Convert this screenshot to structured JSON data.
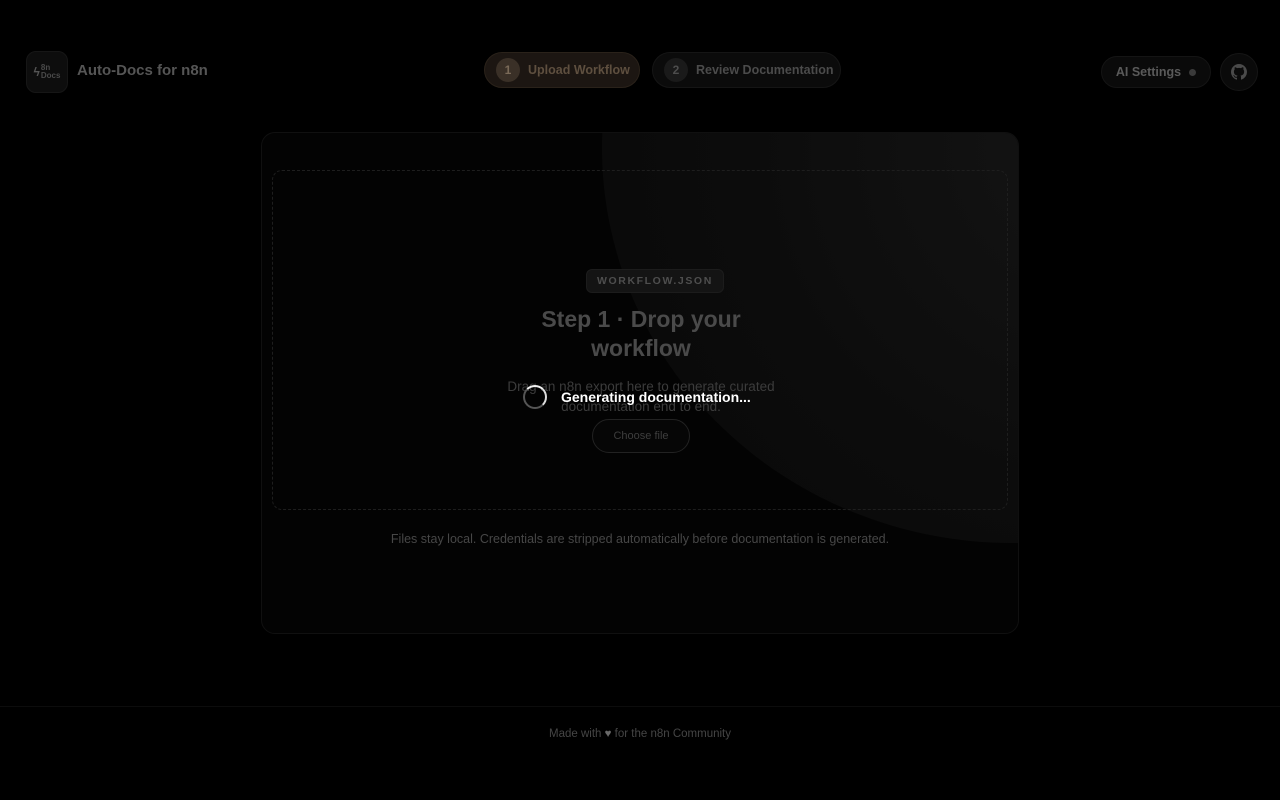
{
  "header": {
    "logo_top": "8n",
    "logo_bottom": "Docs",
    "app_title": "Auto-Docs for n8n",
    "steps": [
      {
        "number": "1",
        "label": "Upload Workflow",
        "active": true
      },
      {
        "number": "2",
        "label": "Review Documentation",
        "active": false
      }
    ],
    "ai_settings_label": "AI Settings",
    "github_icon": "github-icon"
  },
  "dropzone": {
    "file_badge": "WORKFLOW.JSON",
    "title": "Step 1 · Drop your workflow",
    "description": "Drag an n8n export here to generate curated documentation end to end.",
    "choose_file_label": "Choose file"
  },
  "footnote": "Files stay local. Credentials are stripped automatically before documentation is generated.",
  "loading": {
    "text": "Generating documentation..."
  },
  "footer": {
    "prefix": "Made with",
    "heart": "♥",
    "suffix": "for the n8n Community"
  },
  "colors": {
    "background": "#000000",
    "active_step_accent": "#5e4f3f",
    "loading_text": "#ffffff"
  }
}
